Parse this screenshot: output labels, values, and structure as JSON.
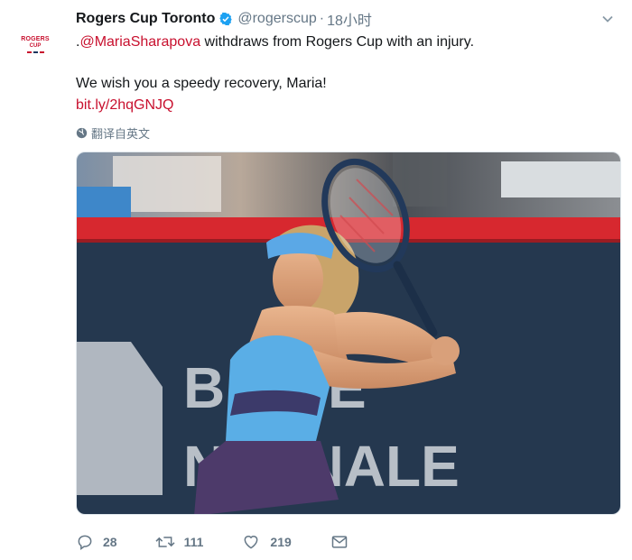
{
  "tweet": {
    "avatar": {
      "line1": "ROGERS",
      "line2": "CUP"
    },
    "display_name": "Rogers Cup Toronto",
    "handle": "@rogerscup",
    "separator": "·",
    "time": "18小时",
    "text_prefix": ".",
    "mention": "@MariaSharapova",
    "text_rest": " withdraws from Rogers Cup with an injury.",
    "line2": "We wish you a speedy recovery, Maria!",
    "url": "bit.ly/2hqGNJQ",
    "translate_label": "翻译自英文",
    "banner_text": {
      "row1": "B  QUE",
      "row2": "N  IONALE"
    }
  },
  "actions": {
    "reply_count": "28",
    "retweet_count": "111",
    "like_count": "219"
  },
  "colors": {
    "accent": "#c8102e",
    "muted": "#657786",
    "verified": "#1da1f2",
    "court_banner": "#25384f"
  },
  "icons": [
    "verified-badge-icon",
    "chevron-down-icon",
    "globe-icon",
    "reply-icon",
    "retweet-icon",
    "heart-icon",
    "envelope-icon"
  ]
}
